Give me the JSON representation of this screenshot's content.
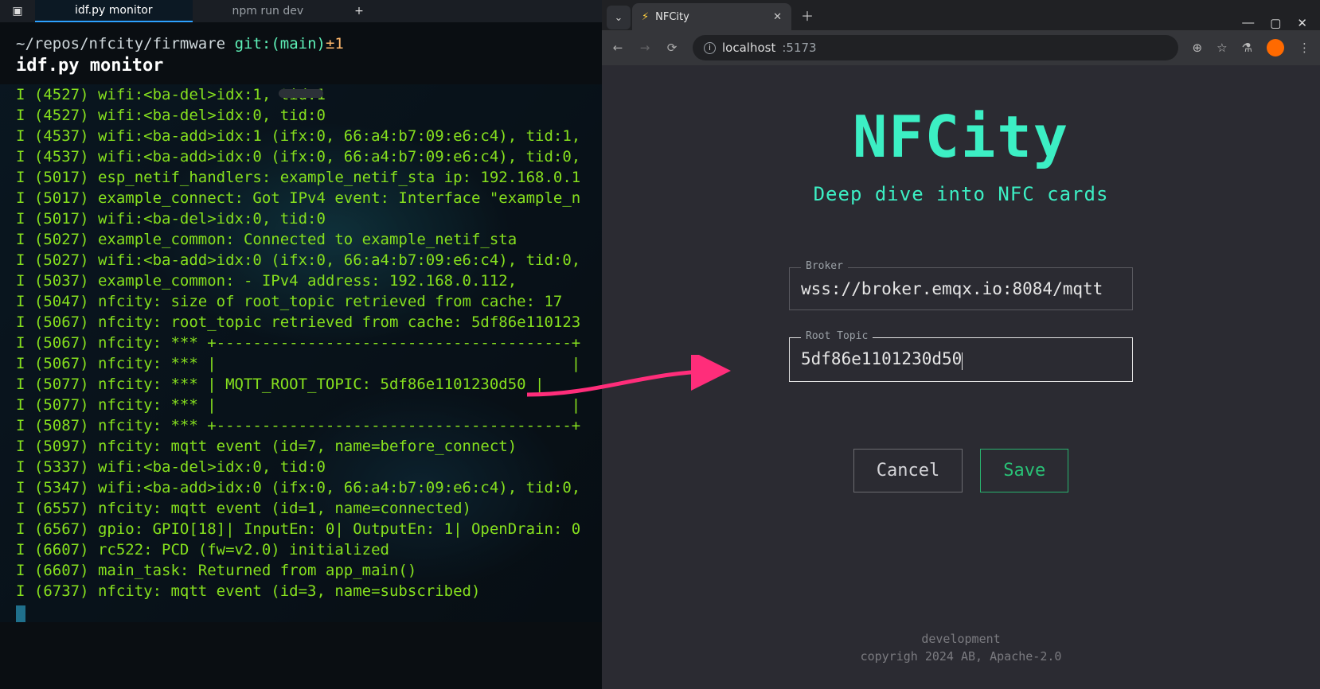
{
  "terminal": {
    "tabs": [
      {
        "label": "idf.py monitor",
        "active": true
      },
      {
        "label": "npm run dev",
        "active": false
      }
    ],
    "prompt_path": "~/repos/nfcity/firmware",
    "prompt_git": "git:(main)",
    "prompt_suffix": "±1",
    "command": "idf.py monitor",
    "lines": [
      "I (4527) wifi:<ba-del>idx:1, tid:1",
      "I (4527) wifi:<ba-del>idx:0, tid:0",
      "I (4537) wifi:<ba-add>idx:1 (ifx:0, 66:a4:b7:09:e6:c4), tid:1,",
      "I (4537) wifi:<ba-add>idx:0 (ifx:0, 66:a4:b7:09:e6:c4), tid:0,",
      "I (5017) esp_netif_handlers: example_netif_sta ip: 192.168.0.1",
      "I (5017) example_connect: Got IPv4 event: Interface \"example_n",
      "I (5017) wifi:<ba-del>idx:0, tid:0",
      "I (5027) example_common: Connected to example_netif_sta",
      "I (5027) wifi:<ba-add>idx:0 (ifx:0, 66:a4:b7:09:e6:c4), tid:0,",
      "I (5037) example_common: - IPv4 address: 192.168.0.112,",
      "I (5047) nfcity: size of root_topic retrieved from cache: 17",
      "I (5067) nfcity: root_topic retrieved from cache: 5df86e110123",
      "I (5067) nfcity: *** +---------------------------------------+",
      "I (5067) nfcity: *** |                                       |",
      "I (5077) nfcity: *** | MQTT_ROOT_TOPIC: 5df86e1101230d50 |",
      "I (5077) nfcity: *** |                                       |",
      "I (5087) nfcity: *** +---------------------------------------+",
      "I (5097) nfcity: mqtt event (id=7, name=before_connect)",
      "I (5337) wifi:<ba-del>idx:0, tid:0",
      "I (5347) wifi:<ba-add>idx:0 (ifx:0, 66:a4:b7:09:e6:c4), tid:0,",
      "I (6557) nfcity: mqtt event (id=1, name=connected)",
      "I (6567) gpio: GPIO[18]| InputEn: 0| OutputEn: 1| OpenDrain: 0",
      "I (6607) rc522: PCD (fw=v2.0) initialized",
      "I (6607) main_task: Returned from app_main()",
      "I (6737) nfcity: mqtt event (id=3, name=subscribed)"
    ]
  },
  "browser": {
    "tab_title": "NFCity",
    "url_host": "localhost",
    "url_port": ":5173",
    "page": {
      "title": "NFCity",
      "subtitle": "Deep dive into NFC cards",
      "broker_label": "Broker",
      "broker_value": "wss://broker.emqx.io:8084/mqtt",
      "root_topic_label": "Root Topic",
      "root_topic_value": "5df86e1101230d50",
      "cancel_label": "Cancel",
      "save_label": "Save",
      "footer_line1": "development",
      "footer_line2": "copyrigh 2024 AB, Apache-2.0"
    }
  }
}
